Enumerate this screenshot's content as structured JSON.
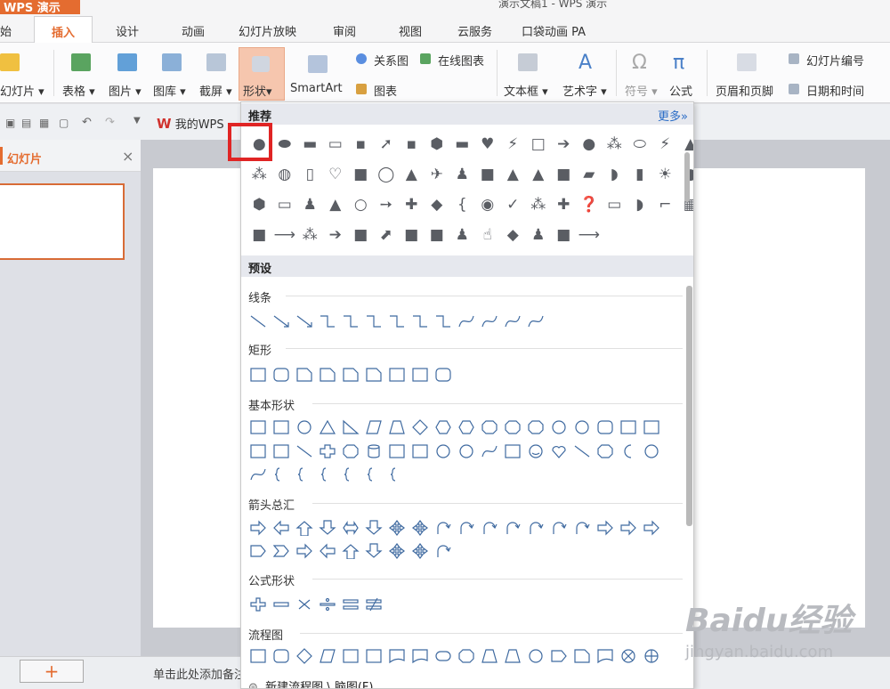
{
  "app": {
    "name": "WPS 演示",
    "doc_title": "演示文稿1 - WPS 演示"
  },
  "tabs": [
    {
      "label": "开始",
      "display": "始"
    },
    {
      "label": "插入"
    },
    {
      "label": "设计"
    },
    {
      "label": "动画"
    },
    {
      "label": "幻灯片放映"
    },
    {
      "label": "审阅"
    },
    {
      "label": "视图"
    },
    {
      "label": "云服务"
    },
    {
      "label": "口袋动画 PA"
    }
  ],
  "ribbon": {
    "new_slide": "幻灯片",
    "table": "表格",
    "picture": "图片",
    "gallery": "图库",
    "screenshot": "截屏",
    "shape": "形状",
    "smartart": "SmartArt",
    "relation": "关系图",
    "online_chart": "在线图表",
    "chart": "图表",
    "textbox": "文本框",
    "wordart": "艺术字",
    "symbol": "符号",
    "formula": "公式",
    "header_footer": "页眉和页脚",
    "slide_number": "幻灯片编号",
    "date_time": "日期和时间"
  },
  "quickbar": {
    "wps": "我的WPS"
  },
  "panel": {
    "title": "幻灯片"
  },
  "status": {
    "add": "+",
    "note": "单击此处添加备注"
  },
  "dropdown": {
    "recommended": "推荐",
    "more": "更多»",
    "preset": "预设",
    "cats": {
      "lines": "线条",
      "rect": "矩形",
      "basic": "基本形状",
      "arrows": "箭头总汇",
      "formula": "公式形状",
      "flow": "流程图"
    },
    "new_flow": "新建流程图 \\ 脑图(F)"
  },
  "watermark": {
    "brand": "Baidu经验",
    "url": "jingyan.baidu.com"
  },
  "colors": {
    "accent": "#e46c30",
    "outline_shape": "#3f6aa0",
    "filled_shape": "#5a5d63",
    "highlight": "#e02424"
  }
}
